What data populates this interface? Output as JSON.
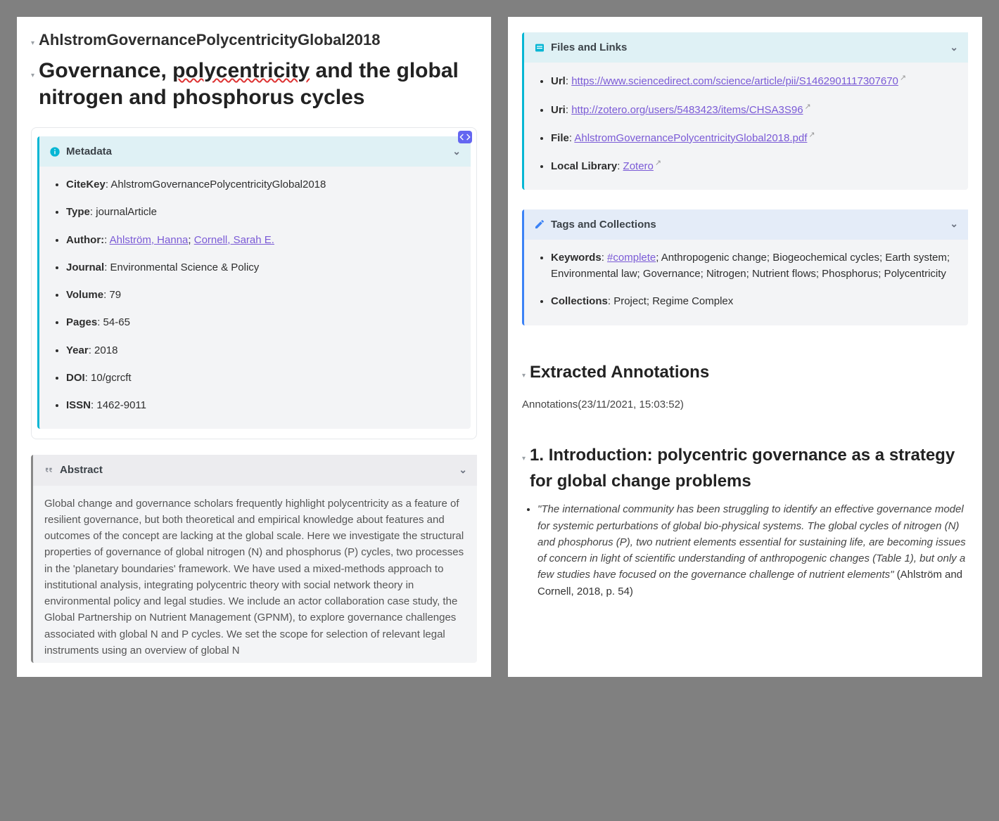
{
  "left": {
    "citekey": "AhlstromGovernancePolycentricityGlobal2018",
    "title_parts": {
      "p1": "Governance, ",
      "wavy": "polycentricity",
      "p2": " and the global nitrogen and phosphorus cycles"
    },
    "metadata": {
      "header": "Metadata",
      "items": {
        "citekey_label": "CiteKey",
        "citekey_value": "AhlstromGovernancePolycentricityGlobal2018",
        "type_label": "Type",
        "type_value": "journalArticle",
        "author_label": "Author:",
        "author1": "Ahlström, Hanna",
        "author2": "Cornell, Sarah E.",
        "journal_label": "Journal",
        "journal_value": "Environmental Science & Policy",
        "volume_label": "Volume",
        "volume_value": "79",
        "pages_label": "Pages",
        "pages_value": "54-65",
        "year_label": "Year",
        "year_value": "2018",
        "doi_label": "DOI",
        "doi_value": "10/gcrcft",
        "issn_label": "ISSN",
        "issn_value": "1462-9011"
      }
    },
    "abstract": {
      "header": "Abstract",
      "text": "Global change and governance scholars frequently highlight polycentricity as a feature of resilient governance, but both theoretical and empirical knowledge about features and outcomes of the concept are lacking at the global scale. Here we investigate the structural properties of governance of global nitrogen (N) and phosphorus (P) cycles, two processes in the 'planetary boundaries' framework. We have used a mixed-methods approach to institutional analysis, integrating polycentric theory with social network theory in environmental policy and legal studies. We include an actor collaboration case study, the Global Partnership on Nutrient Management (GPNM), to explore governance challenges associated with global N and P cycles. We set the scope for selection of relevant legal instruments using an overview of global N"
    }
  },
  "right": {
    "files": {
      "header": "Files and Links",
      "url_label": "Url",
      "url_value": "https://www.sciencedirect.com/science/article/pii/S1462901117307670",
      "uri_label": "Uri",
      "uri_value": "http://zotero.org/users/5483423/items/CHSA3S96",
      "file_label": "File",
      "file_value": "AhlstromGovernancePolycentricityGlobal2018.pdf",
      "local_label": "Local Library",
      "local_value": "Zotero"
    },
    "tags": {
      "header": "Tags and Collections",
      "keywords_label": "Keywords",
      "keywords_link": "#complete",
      "keywords_rest": "; Anthropogenic change; Biogeochemical cycles; Earth system; Environmental law; Governance; Nitrogen; Nutrient flows; Phosphorus; Polycentricity",
      "collections_label": "Collections",
      "collections_value": "Project; Regime Complex"
    },
    "extracted_heading": "Extracted Annotations",
    "annotations_meta": "Annotations(23/11/2021, 15:03:52)",
    "intro_heading": "1. Introduction: polycentric governance as a strategy for global change problems",
    "quote": "\"The international community has been struggling to identify an effective governance model for systemic perturbations of global bio-physical systems. The global cycles of nitrogen (N) and phosphorus (P), two nutrient elements essential for sustaining life, are becoming issues of concern in light of scientific understanding of anthropogenic changes (Table 1), but only a few studies have focused on the governance challenge of nutrient elements\"",
    "quote_cite": " (Ahlström and Cornell, 2018, p. 54)"
  }
}
